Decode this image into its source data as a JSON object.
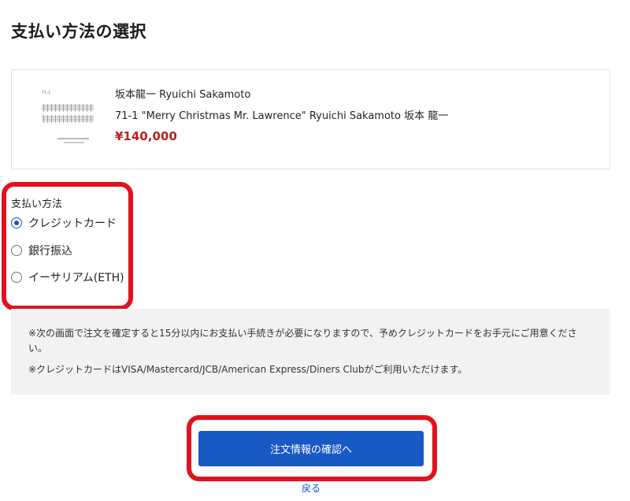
{
  "page_title": "支払い方法の選択",
  "product": {
    "thumbnail_number": "71-1",
    "artist": "坂本龍一 Ryuichi Sakamoto",
    "title": "71-1 \"Merry Christmas Mr. Lawrence\" Ryuichi Sakamoto 坂本 龍一",
    "price": "¥140,000"
  },
  "payment": {
    "label": "支払い方法",
    "options": [
      {
        "label": "クレジットカード",
        "selected": true
      },
      {
        "label": "銀行振込",
        "selected": false
      },
      {
        "label": "イーサリアム(ETH)",
        "selected": false
      }
    ]
  },
  "notice": {
    "lines": [
      "※次の画面で注文を確定すると15分以内にお支払い手続きが必要になりますので、予めクレジットカードをお手元にご用意ください。",
      "※クレジットカードはVISA/Mastercard/JCB/American Express/Diners Clubがご利用いただけます。"
    ]
  },
  "actions": {
    "confirm_label": "注文情報の確認へ",
    "back_label": "戻る"
  },
  "colors": {
    "primary": "#1859c4",
    "price": "#b8231f",
    "highlight": "#e0121e"
  }
}
